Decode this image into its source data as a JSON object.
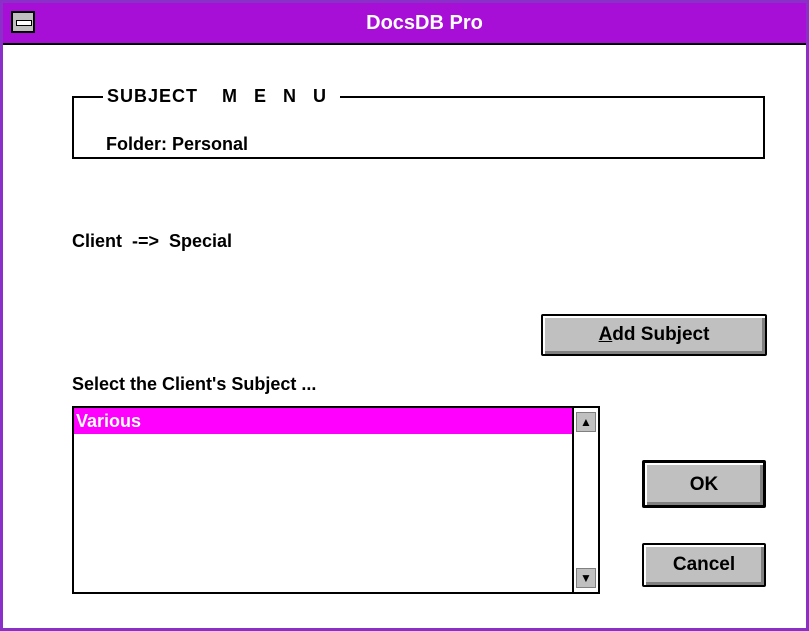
{
  "window": {
    "title": "DocsDB Pro"
  },
  "group": {
    "legend_subject": "SUBJECT",
    "legend_menu": "M E N U",
    "folder_label": "Folder: Personal"
  },
  "client_line": "Client  -=>  Special",
  "buttons": {
    "add_subject_accel": "A",
    "add_subject_rest": "dd Subject",
    "ok": "OK",
    "cancel": "Cancel"
  },
  "list": {
    "label": "Select the Client's Subject ...",
    "items": [
      "Various"
    ],
    "selected_index": 0
  },
  "icons": {
    "system_menu": "system-menu-icon",
    "scroll_up": "scroll-up-arrow-icon",
    "scroll_down": "scroll-down-arrow-icon"
  },
  "colors": {
    "title_bar": "#a80fd6",
    "selection": "#ff00ff",
    "button_face": "#c0c0c0"
  }
}
